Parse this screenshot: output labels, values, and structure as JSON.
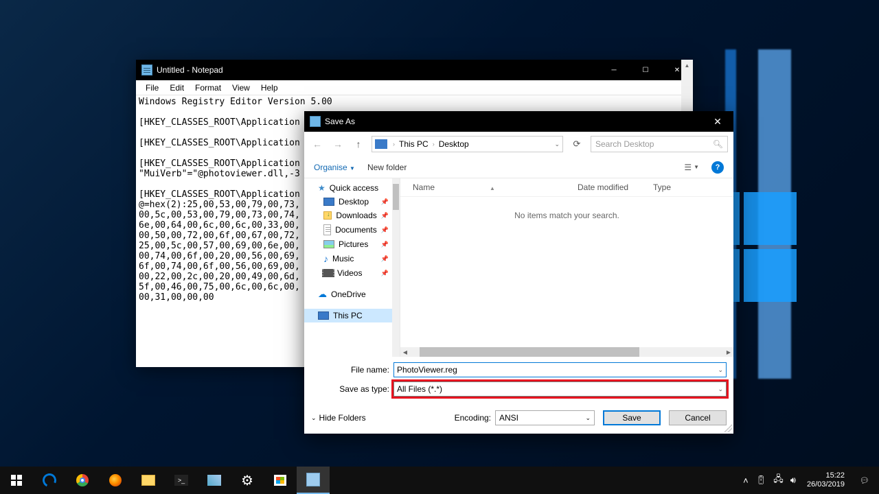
{
  "notepad": {
    "title": "Untitled - Notepad",
    "menus": [
      "File",
      "Edit",
      "Format",
      "View",
      "Help"
    ],
    "content": "Windows Registry Editor Version 5.00\n\n[HKEY_CLASSES_ROOT\\Application\n\n[HKEY_CLASSES_ROOT\\Application\n\n[HKEY_CLASSES_ROOT\\Application\n\"MuiVerb\"=\"@photoviewer.dll,-3\n\n[HKEY_CLASSES_ROOT\\Application\n@=hex(2):25,00,53,00,79,00,73,\n00,5c,00,53,00,79,00,73,00,74,\n6e,00,64,00,6c,00,6c,00,33,00,\n00,50,00,72,00,6f,00,67,00,72,\n25,00,5c,00,57,00,69,00,6e,00,\n00,74,00,6f,00,20,00,56,00,69,\n6f,00,74,00,6f,00,56,00,69,00,\n00,22,00,2c,00,20,00,49,00,6d,\n5f,00,46,00,75,00,6c,00,6c,00,\n00,31,00,00,00"
  },
  "save_dialog": {
    "title": "Save As",
    "breadcrumb": {
      "root": "This PC",
      "current": "Desktop"
    },
    "search_placeholder": "Search Desktop",
    "toolbar": {
      "organise": "Organise",
      "new_folder": "New folder"
    },
    "nav_pane": {
      "quick_access": "Quick access",
      "items": [
        {
          "label": "Desktop",
          "icon": "desktop",
          "pinned": true
        },
        {
          "label": "Downloads",
          "icon": "downloads",
          "pinned": true
        },
        {
          "label": "Documents",
          "icon": "doc",
          "pinned": true
        },
        {
          "label": "Pictures",
          "icon": "pic",
          "pinned": true
        },
        {
          "label": "Music",
          "icon": "music",
          "pinned": true
        },
        {
          "label": "Videos",
          "icon": "video",
          "pinned": true
        }
      ],
      "onedrive": "OneDrive",
      "this_pc": "This PC"
    },
    "columns": {
      "name": "Name",
      "date": "Date modified",
      "type": "Type"
    },
    "empty_msg": "No items match your search.",
    "filename_label": "File name:",
    "filename_value": "PhotoViewer.reg",
    "filetype_label": "Save as type:",
    "filetype_value": "All Files  (*.*)",
    "hide_folders": "Hide Folders",
    "encoding_label": "Encoding:",
    "encoding_value": "ANSI",
    "save_btn": "Save",
    "cancel_btn": "Cancel"
  },
  "taskbar": {
    "time": "15:22",
    "date": "26/03/2019"
  }
}
